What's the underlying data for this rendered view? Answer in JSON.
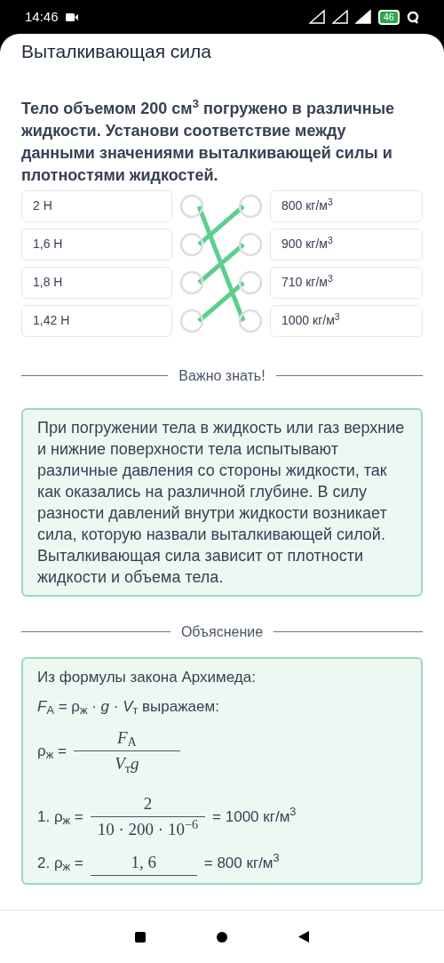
{
  "status_bar": {
    "time": "14:46",
    "battery": "46"
  },
  "title": "Выталкивающая сила",
  "question": "Тело объемом 200 см$^{3}$ погружено в различные жидкости. Установи соответствие между данными значениями выталкивающей силы и плотностями жидкостей.",
  "left_items": [
    {
      "text": "2 Н",
      "links": [
        false,
        false,
        false,
        true
      ]
    },
    {
      "text": "1,6 Н",
      "links": [
        true,
        false,
        false,
        false
      ]
    },
    {
      "text": "1,8 Н",
      "links": [
        false,
        true,
        false,
        false
      ]
    },
    {
      "text": "1,42 Н",
      "links": [
        false,
        false,
        true,
        false
      ]
    }
  ],
  "right_items": [
    {
      "text": "800 кг/м$^{3}$"
    },
    {
      "text": "900 кг/м$^{3}$"
    },
    {
      "text": "710 кг/м$^{3}$"
    },
    {
      "text": "1000 кг/м$^{3}$"
    }
  ],
  "important": {
    "heading": "Важно знать!",
    "text": "При погружении тела в жидкость или газ верхние и нижние поверхности тела испытывают различные давления со стороны жидкости, так как оказались на различной глубине. В силу разности давлений внутри жидкости возникает сила, которую назвали выталкивающей силой. Выталкивающая сила зависит от плотности жидкости и объема тела."
  },
  "explanation": {
    "heading": "Объяснение",
    "intro": "Из формулы закона Архимеда:",
    "formula": "*F*$_{А}$ = ρ$_{ж}$ · *g* · *V*$_{т}$ выражаем:",
    "general": {
      "lhs": "ρ$_{ж}$ =",
      "numerator": "*F*$_{A}$",
      "denominator": "*V*$_{т}$*g*"
    },
    "steps": [
      {
        "lhs": "1. ρ$_{ж}$ =",
        "numerator": "2",
        "denominator": "10 · 200 · 10$^{−6}$",
        "result": "= 1000 кг/м$^{3}$"
      },
      {
        "lhs": "2. ρ$_{ж}$ =",
        "numerator": "1, 6",
        "result": "= 800 кг/м$^{3}$"
      }
    ]
  }
}
